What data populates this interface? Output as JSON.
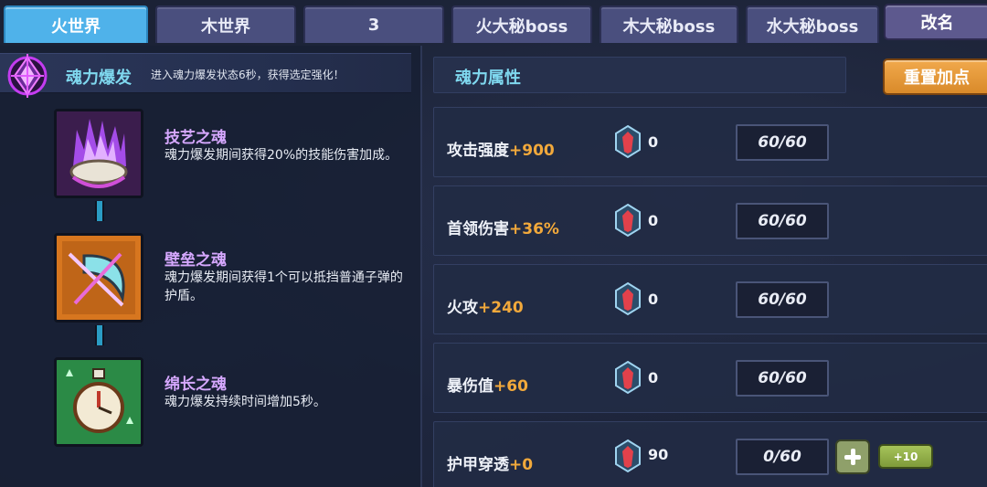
{
  "tabs": [
    {
      "label": "火世界",
      "active": true
    },
    {
      "label": "木世界",
      "active": false
    },
    {
      "label": "3",
      "active": false
    },
    {
      "label": "火大秘boss",
      "active": false
    },
    {
      "label": "木大秘boss",
      "active": false
    },
    {
      "label": "水大秘boss",
      "active": false
    }
  ],
  "rename_label": "改名",
  "burst": {
    "title": "魂力爆发",
    "description": "进入魂力爆发状态6秒，获得选定强化！",
    "icon": "purple-diamond-sigil-icon"
  },
  "souls": [
    {
      "name": "技艺之魂",
      "description": "魂力爆发期间获得20%的技能伤害加成。",
      "icon": "purple-flame-shell-icon"
    },
    {
      "name": "壁垒之魂",
      "description": "魂力爆发期间获得1个可以抵挡普通子弹的护盾。",
      "icon": "crescent-shield-icon"
    },
    {
      "name": "绵长之魂",
      "description": "魂力爆发持续时间增加5秒。",
      "icon": "stopwatch-icon"
    }
  ],
  "attributes_title": "魂力属性",
  "reset_label": "重置加点",
  "attributes": [
    {
      "label": "攻击强度",
      "bonus": "+900",
      "gems": "0",
      "level": "60/60"
    },
    {
      "label": "首领伤害",
      "bonus": "+36%",
      "gems": "0",
      "level": "60/60"
    },
    {
      "label": "火攻",
      "bonus": "+240",
      "gems": "0",
      "level": "60/60"
    },
    {
      "label": "暴伤值",
      "bonus": "+60",
      "gems": "0",
      "level": "60/60"
    },
    {
      "label": "护甲穿透",
      "bonus": "+0",
      "gems": "90",
      "level": "0/60",
      "plus10_label": "+10"
    }
  ],
  "colors": {
    "accent_cyan": "#7fd8ef",
    "bonus_orange": "#f2a93b",
    "soul_name": "#d6a8ff",
    "tab_active": "#4fb2ea",
    "reset_orange": "#e99a3a"
  }
}
